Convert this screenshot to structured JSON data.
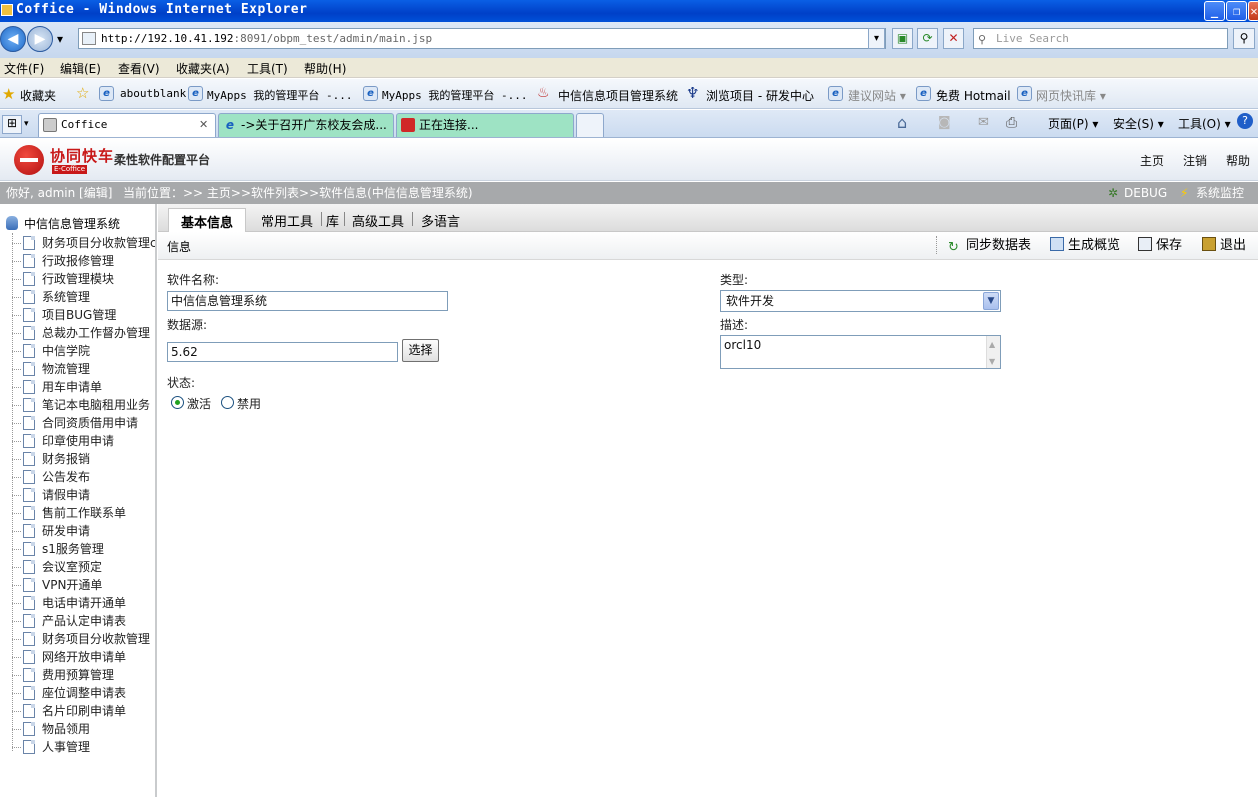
{
  "window": {
    "title": "Coffice - Windows Internet Explorer",
    "minimize": "_",
    "restore": "❐",
    "close": "✕"
  },
  "browser": {
    "back": "◀",
    "forward": "▶",
    "dropdown": "▾",
    "address_host": "http://192.10.41.192",
    "address_rest": ":8091/obpm_test/admin/main.jsp",
    "search_placeholder": "Live Search",
    "menu": [
      "文件(F)",
      "编辑(E)",
      "查看(V)",
      "收藏夹(A)",
      "工具(T)",
      "帮助(H)"
    ],
    "favorites_label": "收藏夹",
    "favorites": [
      {
        "label": "aboutblank",
        "mono": true
      },
      {
        "label": "MyApps 我的管理平台 -...",
        "mono": true
      },
      {
        "label": "MyApps 我的管理平台 -...",
        "mono": true
      },
      {
        "label": "中信信息项目管理系统",
        "mono": false
      },
      {
        "label": "浏览项目 - 研发中心",
        "mono": false
      },
      {
        "label": "建议网站 ▾",
        "mono": false,
        "grey": true
      },
      {
        "label": "免费 Hotmail",
        "mono": false
      },
      {
        "label": "网页快讯库 ▾",
        "mono": false,
        "grey": true
      }
    ],
    "tabs": [
      {
        "label": "Coffice",
        "active": true
      },
      {
        "label": "->关于召开广东校友会成...",
        "active": false
      },
      {
        "label": "正在连接...",
        "active": false
      }
    ],
    "tab_close": "✕",
    "commands": [
      "页面(P) ▾",
      "安全(S) ▾",
      "工具(O) ▾"
    ]
  },
  "app": {
    "brand": "协同快车",
    "brand_sub": "E-Coffice",
    "platform": "柔性软件配置平台",
    "header_links": [
      "主页",
      "注销",
      "帮助"
    ],
    "greeting": "你好, admin [编辑]",
    "breadcrumb": "当前位置：>> 主页>>软件列表>>软件信息(中信信息管理系统)",
    "debug": "DEBUG",
    "monitor": "系统监控",
    "tree_root": "中信信息管理系统",
    "tree_items": [
      "财务项目分收款管理c",
      "行政报修管理",
      "行政管理模块",
      "系统管理",
      "项目BUG管理",
      "总裁办工作督办管理",
      "中信学院",
      "物流管理",
      "用车申请单",
      "笔记本电脑租用业务",
      "合同资质借用申请",
      "印章使用申请",
      "财务报销",
      "公告发布",
      "请假申请",
      "售前工作联系单",
      "研发申请",
      "s1服务管理",
      "会议室预定",
      "VPN开通单",
      "电话申请开通单",
      "产品认定申请表",
      "财务项目分收款管理",
      "网络开放申请单",
      "费用预算管理",
      "座位调整申请表",
      "名片印刷申请单",
      "物品领用",
      "人事管理"
    ],
    "panel_tabs": [
      "基本信息",
      "常用工具",
      "库",
      "高级工具",
      "多语言"
    ],
    "section_label": "信息",
    "toolbar": {
      "sync": "同步数据表",
      "overview": "生成概览",
      "save": "保存",
      "exit": "退出"
    },
    "form": {
      "name_label": "软件名称:",
      "name_value": "中信信息管理系统",
      "ds_label": "数据源:",
      "ds_value": "5.62",
      "choose": "选择",
      "status_label": "状态:",
      "active": "激活",
      "disabled": "禁用",
      "type_label": "类型:",
      "type_value": "软件开发",
      "desc_label": "描述:",
      "desc_value": "orcl10"
    }
  }
}
